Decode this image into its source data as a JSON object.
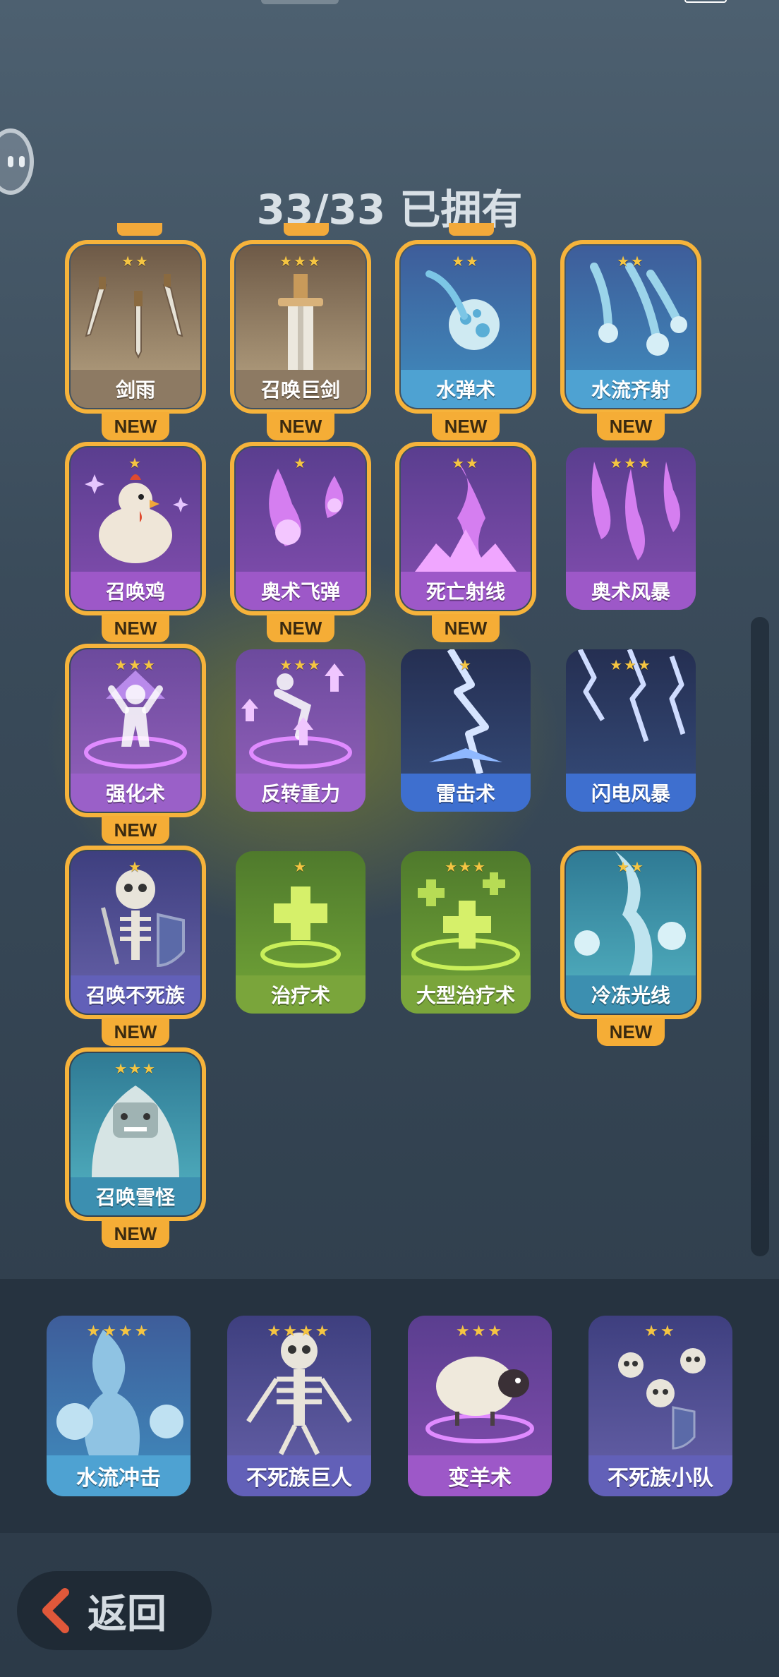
{
  "header": {
    "title": "33/33 已拥有"
  },
  "cards": [
    {
      "label": "剑雨",
      "stars": "★★",
      "theme": "sword",
      "art": "falling-swords-icon",
      "owned": true,
      "new": "NEW"
    },
    {
      "label": "召唤巨剑",
      "stars": "★★★",
      "theme": "sword",
      "art": "giant-sword-icon",
      "owned": true,
      "new": "NEW"
    },
    {
      "label": "水弹术",
      "stars": "★★",
      "theme": "water",
      "art": "water-bullet-icon",
      "owned": true,
      "new": "NEW"
    },
    {
      "label": "水流齐射",
      "stars": "★★",
      "theme": "water",
      "art": "water-volley-icon",
      "owned": true,
      "new": "NEW"
    },
    {
      "label": "召唤鸡",
      "stars": "★",
      "theme": "purple",
      "art": "chicken-icon",
      "owned": true,
      "new": "NEW"
    },
    {
      "label": "奥术飞弹",
      "stars": "★",
      "theme": "purple",
      "art": "arcane-missile-icon",
      "owned": true,
      "new": "NEW"
    },
    {
      "label": "死亡射线",
      "stars": "★★",
      "theme": "purple",
      "art": "death-ray-icon",
      "owned": true,
      "new": "NEW"
    },
    {
      "label": "奥术风暴",
      "stars": "★★★",
      "theme": "purple",
      "art": "arcane-storm-icon",
      "owned": false,
      "new": ""
    },
    {
      "label": "强化术",
      "stars": "★★★",
      "theme": "purple2",
      "art": "empower-icon",
      "owned": true,
      "new": "NEW"
    },
    {
      "label": "反转重力",
      "stars": "★★★",
      "theme": "purple2",
      "art": "reverse-gravity-icon",
      "owned": false,
      "new": ""
    },
    {
      "label": "雷击术",
      "stars": "★",
      "theme": "storm",
      "art": "lightning-icon",
      "owned": false,
      "new": ""
    },
    {
      "label": "闪电风暴",
      "stars": "★★★",
      "theme": "storm",
      "art": "lightning-storm-icon",
      "owned": false,
      "new": ""
    },
    {
      "label": "召唤不死族",
      "stars": "★",
      "theme": "undead",
      "art": "skeleton-icon",
      "owned": true,
      "new": "NEW"
    },
    {
      "label": "治疗术",
      "stars": "★",
      "theme": "green",
      "art": "heal-icon",
      "owned": false,
      "new": ""
    },
    {
      "label": "大型治疗术",
      "stars": "★★★",
      "theme": "green",
      "art": "greater-heal-icon",
      "owned": false,
      "new": ""
    },
    {
      "label": "冷冻光线",
      "stars": "★★",
      "theme": "ice",
      "art": "freeze-ray-icon",
      "owned": true,
      "new": "NEW"
    },
    {
      "label": "召唤雪怪",
      "stars": "★★★",
      "theme": "ice",
      "art": "yeti-icon",
      "owned": true,
      "new": "NEW"
    }
  ],
  "bottom_cards": [
    {
      "label": "水流冲击",
      "stars": "★★★★",
      "theme": "water",
      "art": "water-blast-icon"
    },
    {
      "label": "不死族巨人",
      "stars": "★★★★",
      "theme": "undead",
      "art": "skeleton-giant-icon"
    },
    {
      "label": "变羊术",
      "stars": "★★★",
      "theme": "purple",
      "art": "sheep-icon"
    },
    {
      "label": "不死族小队",
      "stars": "★★",
      "theme": "undead",
      "art": "skeleton-squad-icon"
    }
  ],
  "back_button": {
    "label": "返回"
  },
  "colors": {
    "accent": "#f6b33b",
    "star": "#f5c542",
    "panel": "#263340"
  }
}
